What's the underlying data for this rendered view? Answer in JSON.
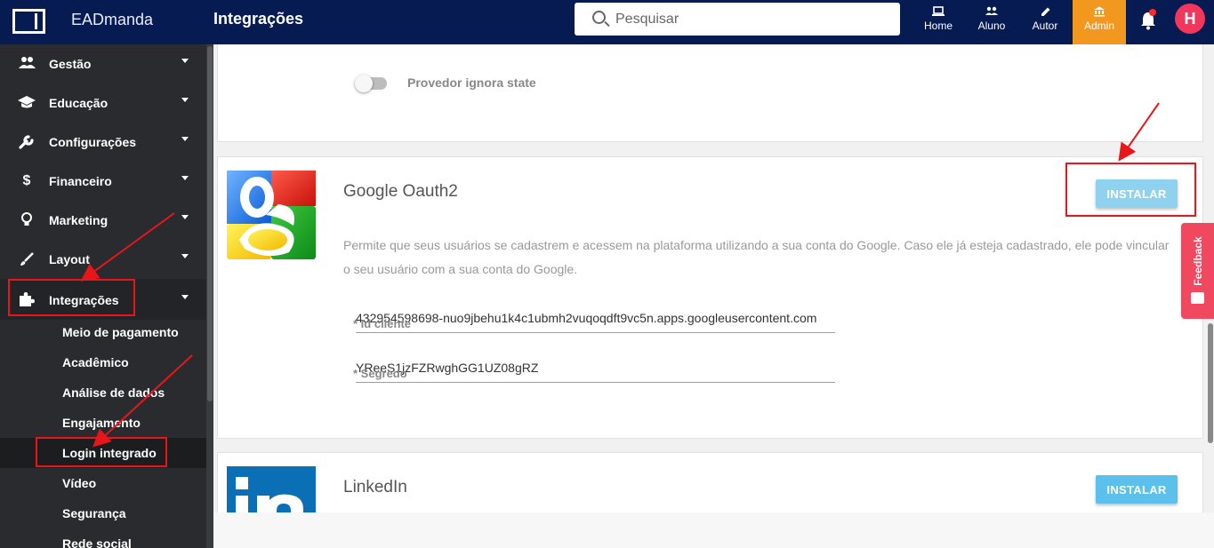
{
  "header": {
    "app_name": "EADmanda",
    "page_title": "Integrações",
    "search_placeholder": "Pesquisar",
    "nav": [
      {
        "label": "Home",
        "icon": "laptop-icon"
      },
      {
        "label": "Aluno",
        "icon": "users-icon"
      },
      {
        "label": "Autor",
        "icon": "pencil-icon"
      },
      {
        "label": "Admin",
        "icon": "bank-icon"
      }
    ],
    "avatar_initial": "H"
  },
  "sidebar": {
    "items": [
      {
        "label": "Gestão",
        "icon": "people-icon"
      },
      {
        "label": "Educação",
        "icon": "graduation-cap-icon"
      },
      {
        "label": "Configurações",
        "icon": "wrench-icon"
      },
      {
        "label": "Financeiro",
        "icon": "dollar-icon"
      },
      {
        "label": "Marketing",
        "icon": "lightbulb-icon"
      },
      {
        "label": "Layout",
        "icon": "brush-icon"
      },
      {
        "label": "Integrações",
        "icon": "puzzle-icon"
      }
    ],
    "subitems": [
      "Meio de pagamento",
      "Acadêmico",
      "Análise de dados",
      "Engajamento",
      "Login integrado",
      "Vídeo",
      "Segurança",
      "Rede social"
    ]
  },
  "content": {
    "previous_card": {
      "toggle_label": "Provedor ignora state",
      "toggle_on": false
    },
    "google": {
      "title": "Google Oauth2",
      "install_label": "INSTALAR",
      "description": "Permite que seus usuários se cadastrem e acessem na plataforma utilizando a sua conta do Google. Caso ele já esteja cadastrado, ele pode vincular o seu usuário com a sua conta do Google.",
      "client_id_label": "* Id cliente",
      "client_id_value": "432954598698-nuo9jbehu1k4c1ubmh2vuqoqdft9vc5n.apps.googleusercontent.com",
      "secret_label": "* Segredo",
      "secret_value": "YReeS1jzFZRwghGG1UZ08gRZ"
    },
    "linkedin": {
      "title": "LinkedIn",
      "install_label": "INSTALAR",
      "logo_text": "in"
    }
  },
  "feedback": {
    "label": "Feedback"
  },
  "colors": {
    "header_bg": "#061b52",
    "admin_accent": "#f3981f",
    "sidebar_bg": "#2a2b2e",
    "install_button": "#5bc0eb",
    "annotation_red": "#e8161b",
    "feedback_bg": "#f0495f"
  }
}
